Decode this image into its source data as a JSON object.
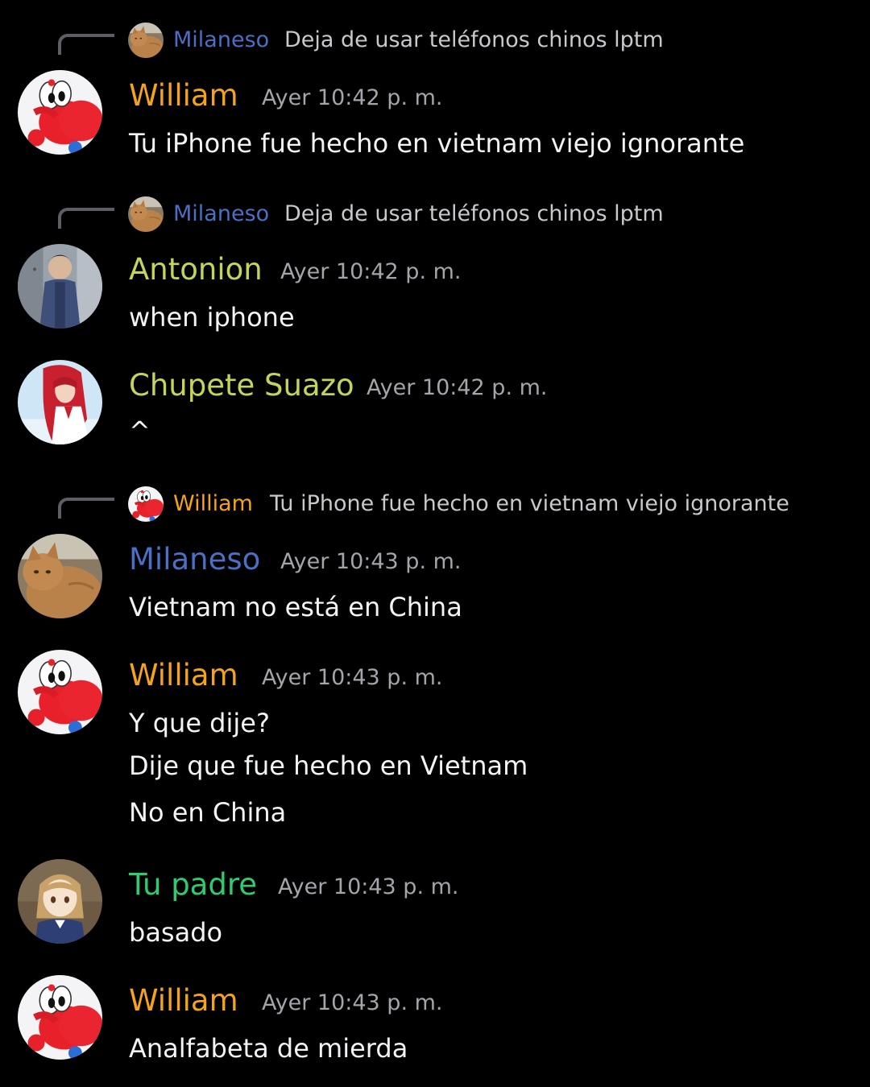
{
  "colors": {
    "background": "#000000",
    "william": "#f5a31a",
    "milaneso": "#4a6fc4",
    "antonion": "#c6d35a",
    "chupete": "#c6d35a",
    "tu_padre": "#2ecc71",
    "timestamp": "#a3a5aa",
    "reply_text": "#c8c9cc",
    "message_text": "#f2f3f5"
  },
  "messages": [
    {
      "reply": {
        "author": "Milaneso",
        "text": "Deja de usar teléfonos chinos lptm",
        "avatar_icon": "cat-avatar-icon"
      },
      "author": "William",
      "timestamp": "Ayer 10:42 p. m.",
      "lines": [
        "Tu iPhone fue hecho en vietnam viejo ignorante"
      ],
      "avatar_icon": "red-yoshi-avatar-icon"
    },
    {
      "reply": {
        "author": "Milaneso",
        "text": "Deja de usar teléfonos chinos lptm",
        "avatar_icon": "cat-avatar-icon"
      },
      "author": "Antonion",
      "timestamp": "Ayer 10:42 p. m.",
      "lines": [
        "when iphone"
      ],
      "avatar_icon": "anime-man-avatar-icon"
    },
    {
      "author": "Chupete Suazo",
      "timestamp": "Ayer 10:42 p. m.",
      "lines": [
        "^"
      ],
      "avatar_icon": "red-hair-anime-avatar-icon"
    },
    {
      "reply": {
        "author": "William",
        "text": "Tu iPhone fue hecho en vietnam viejo ignorante",
        "avatar_icon": "red-yoshi-avatar-icon"
      },
      "author": "Milaneso",
      "timestamp": "Ayer 10:43 p. m.",
      "lines": [
        "Vietnam no está en China"
      ],
      "avatar_icon": "cat-avatar-icon"
    },
    {
      "author": "William",
      "timestamp": "Ayer 10:43 p. m.",
      "lines": [
        "Y que dije?",
        "Dije que fue hecho en Vietnam",
        "No en China"
      ],
      "avatar_icon": "red-yoshi-avatar-icon"
    },
    {
      "author": "Tu padre",
      "timestamp": "Ayer 10:43 p. m.",
      "lines": [
        "basado"
      ],
      "avatar_icon": "anime-girl-avatar-icon"
    },
    {
      "author": "William",
      "timestamp": "Ayer 10:43 p. m.",
      "lines": [
        "Analfabeta de mierda"
      ],
      "avatar_icon": "red-yoshi-avatar-icon"
    }
  ]
}
